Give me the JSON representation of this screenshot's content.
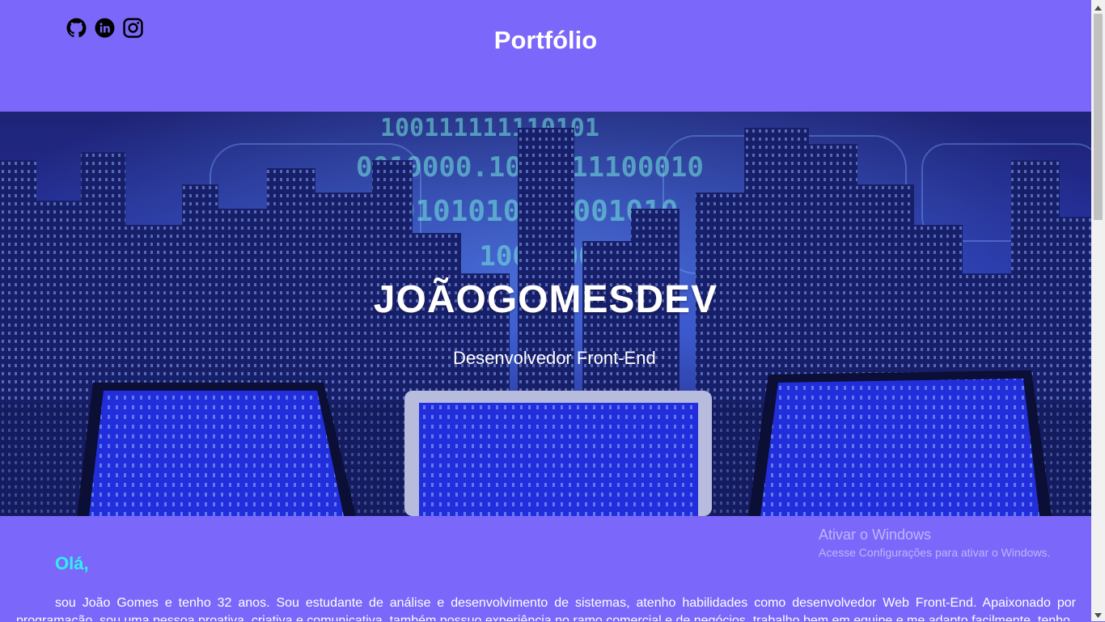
{
  "header": {
    "title": "Portfólio",
    "socials": [
      {
        "icon": "github-icon"
      },
      {
        "icon": "linkedin-icon"
      },
      {
        "icon": "instagram-icon"
      }
    ]
  },
  "hero": {
    "name": "JOÃOGOMESDEV",
    "role": "Desenvolvedor Front-End"
  },
  "about": {
    "greeting": "Olá,",
    "bio": "sou João Gomes e tenho 32 anos. Sou estudante de análise e desenvolvimento de sistemas, atenho habilidades como desenvolvedor Web Front-End. Apaixonado por programação, sou uma pessoa proativa, criativa e comunicativa, também possuo experiência no ramo comercial e de negócios, trabalho bem em equipe e me adapto facilmente, tenho"
  },
  "watermark": {
    "title": "Ativar o Windows",
    "subtitle": "Acesse Configurações para ativar o Windows."
  },
  "colors": {
    "background": "#7b68fa",
    "greeting": "#2ff0f5",
    "text": "#ffffff"
  }
}
